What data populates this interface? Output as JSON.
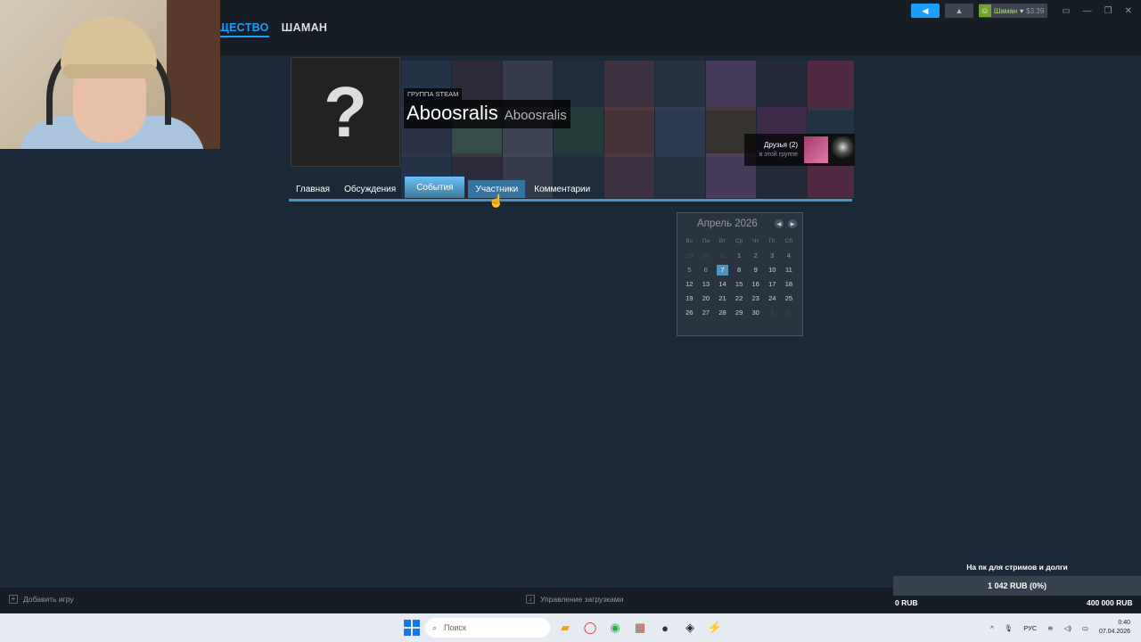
{
  "topnav": {
    "community": "ЩЕСТВО",
    "user": "ШАМАН",
    "account_name": "Шаман",
    "account_balance": "$3.39"
  },
  "group": {
    "label": "ГРУППА STEAM",
    "name": "Aboosralis",
    "tag": "Aboosralis",
    "avatar_glyph": "?",
    "friends_count": "Друзья (2)",
    "friends_sub": "в этой группе"
  },
  "tabs": [
    {
      "label": "Главная"
    },
    {
      "label": "Обсуждения"
    },
    {
      "label": "События"
    },
    {
      "label": "Участники"
    },
    {
      "label": "Комментарии"
    }
  ],
  "calendar": {
    "title": "Апрель 2026",
    "weekdays": [
      "Вс",
      "Пн",
      "Вт",
      "Ср",
      "Чт",
      "Пт",
      "Сб"
    ],
    "days": [
      "29",
      "30",
      "31",
      "1",
      "2",
      "3",
      "4",
      "5",
      "6",
      "7",
      "8",
      "9",
      "10",
      "11",
      "12",
      "13",
      "14",
      "15",
      "16",
      "17",
      "18",
      "19",
      "20",
      "21",
      "22",
      "23",
      "24",
      "25",
      "26",
      "27",
      "28",
      "29",
      "30",
      "1",
      "2"
    ],
    "today": "7"
  },
  "bottombar": {
    "add_game": "Добавить игру",
    "downloads": "Управление загрузками"
  },
  "donation": {
    "title": "На пк для стримов и долги",
    "progress": "1 042 RUB (0%)",
    "min": "0 RUB",
    "max": "400 000 RUB",
    "progress_fraction": 0.0026
  },
  "taskbar": {
    "search_placeholder": "Поиск",
    "lang": "РУС",
    "time": "0:40",
    "date": "07.04.2026"
  },
  "colors": {
    "background": "#1b2838",
    "accent": "#1a9fff",
    "tab_active": "#67c1f5"
  }
}
